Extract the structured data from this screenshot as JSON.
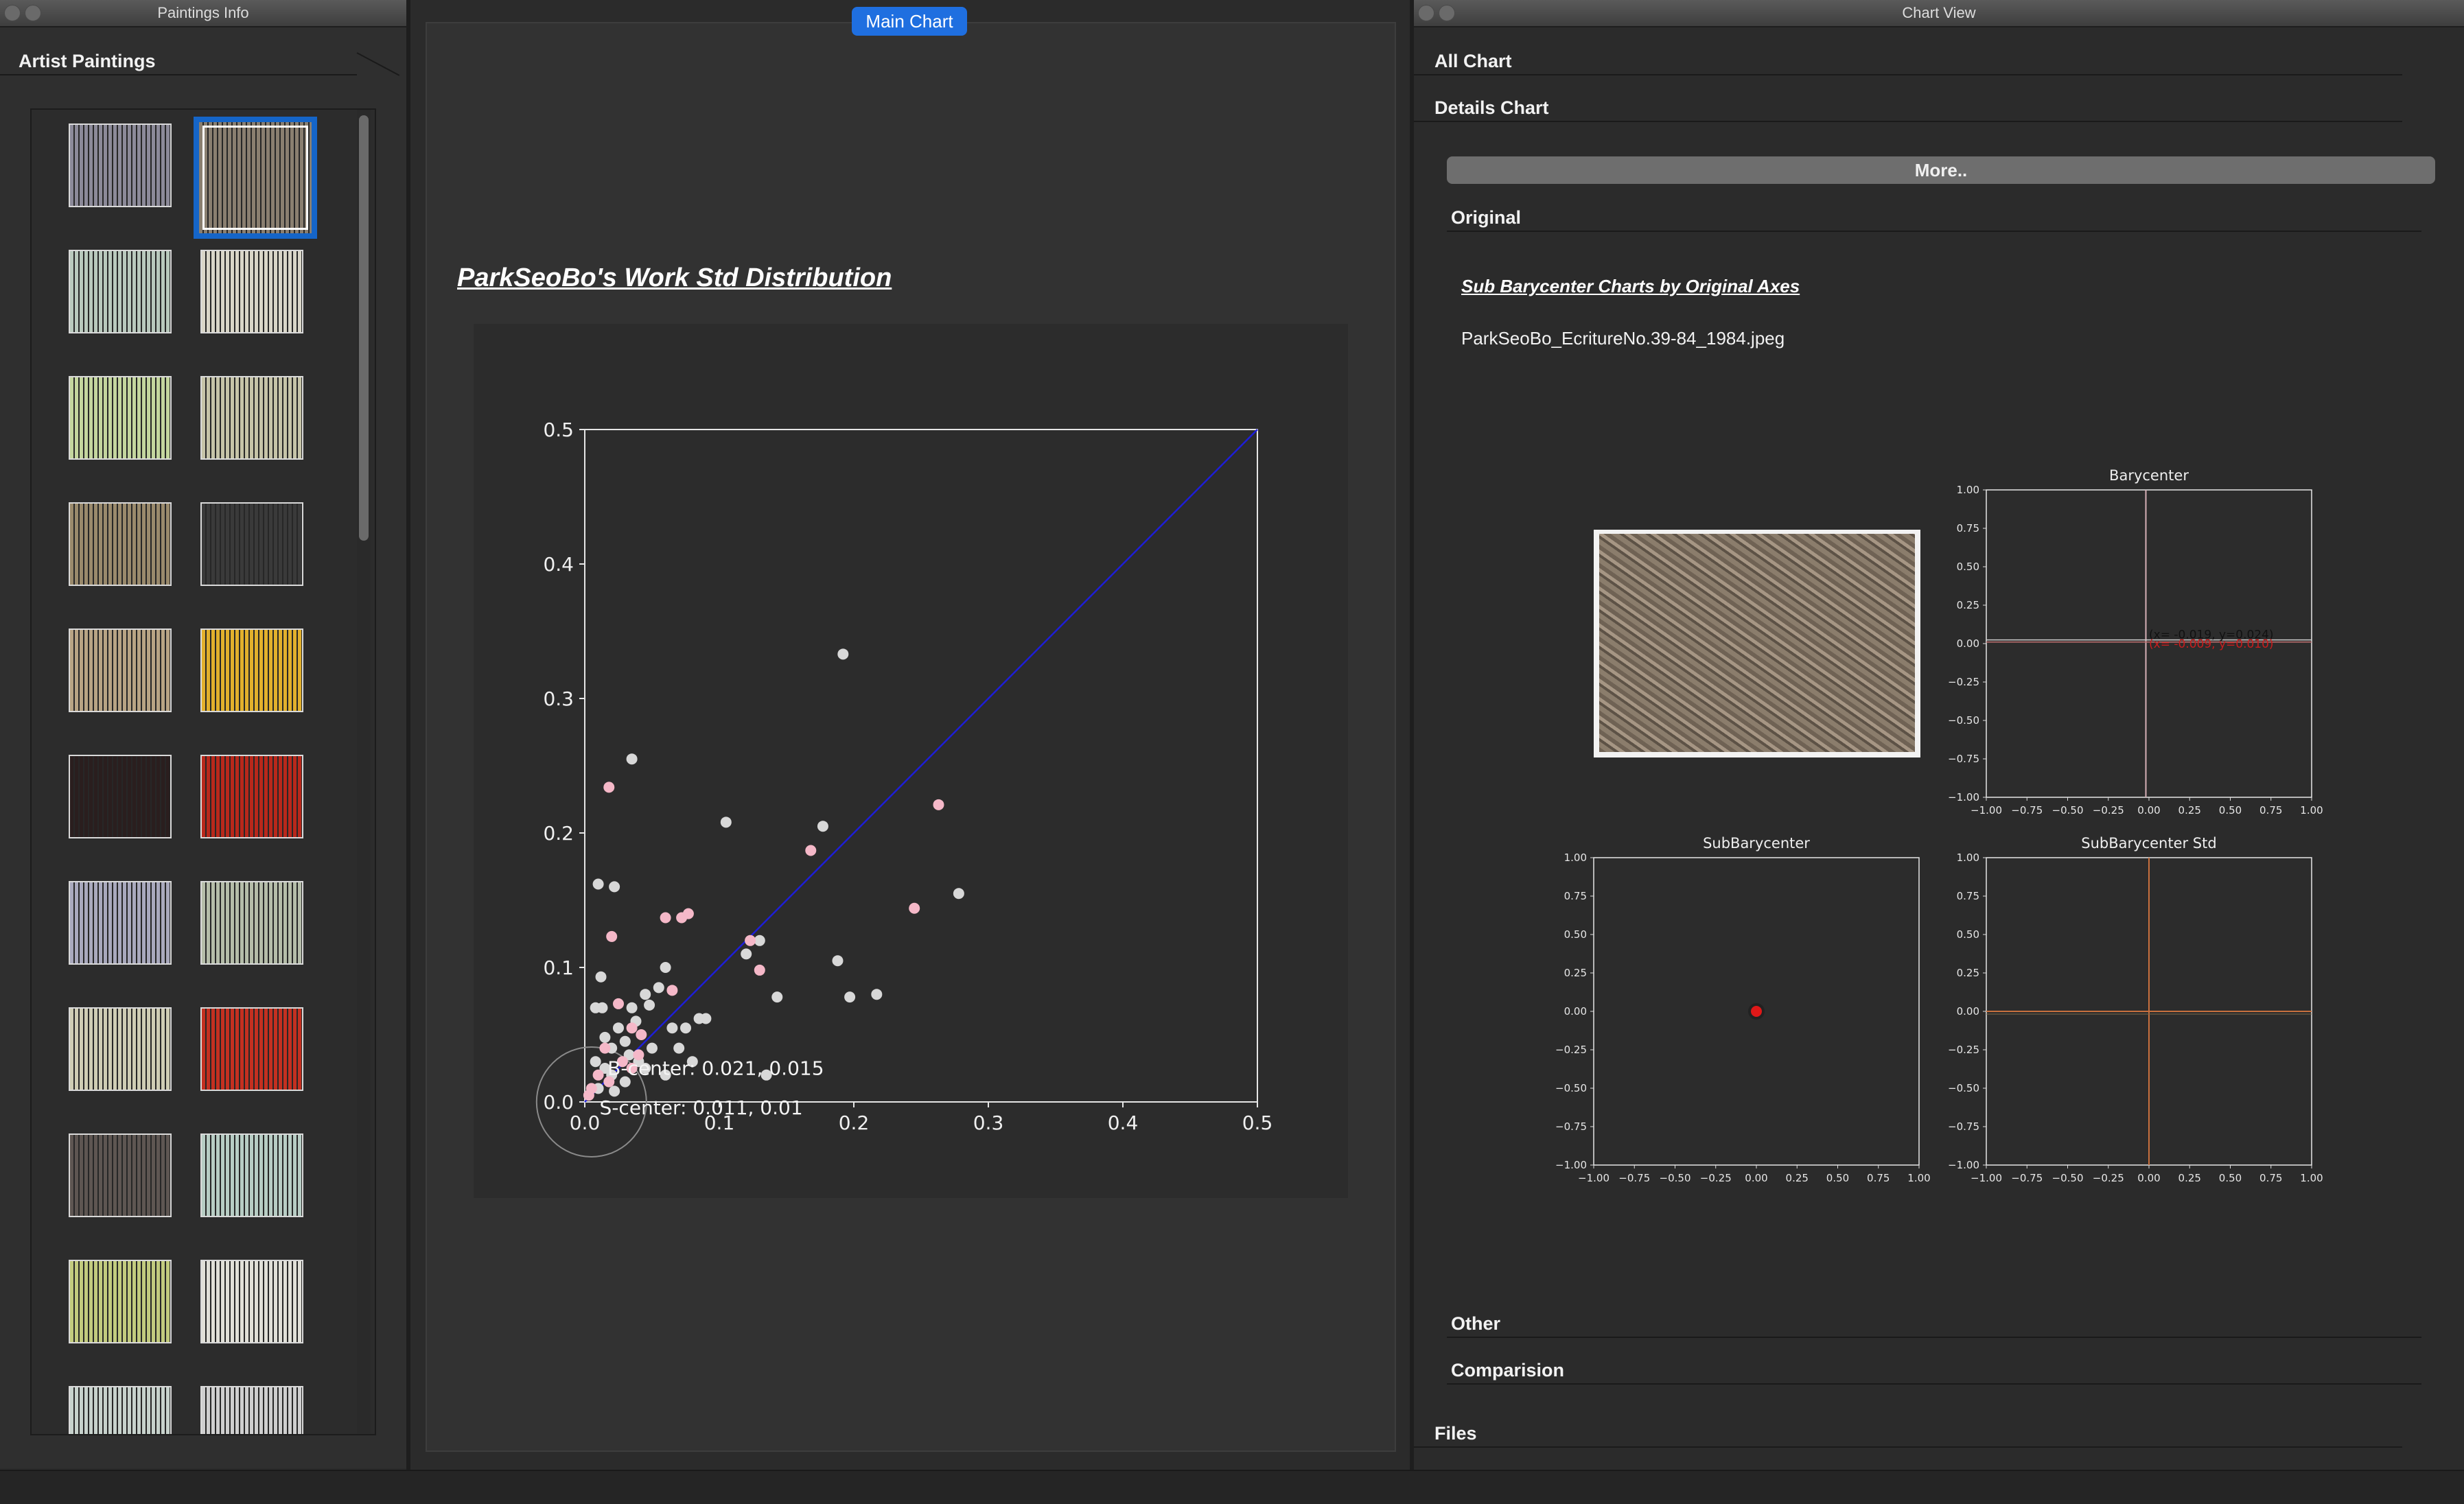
{
  "left_window": {
    "title": "Paintings Info",
    "section": "Artist Paintings"
  },
  "thumbnails": [
    {
      "color": "#8c8a99"
    },
    {
      "color": "#8a7f70"
    },
    {
      "color": "#b9c9bd"
    },
    {
      "color": "#d9d6c8"
    },
    {
      "color": "#c4d69e"
    },
    {
      "color": "#c6c4a8"
    },
    {
      "color": "#9a8a6c"
    },
    {
      "color": "#3a3a3a"
    },
    {
      "color": "#b8a484"
    },
    {
      "color": "#e2b02c"
    },
    {
      "color": "#2a1e1e"
    },
    {
      "color": "#b9281b"
    },
    {
      "color": "#a9a9bd"
    },
    {
      "color": "#b5bda9"
    },
    {
      "color": "#cfcdb4"
    },
    {
      "color": "#c43020"
    },
    {
      "color": "#5e5652"
    },
    {
      "color": "#b7cdc4"
    },
    {
      "color": "#c2cb7e"
    },
    {
      "color": "#e1e0d8"
    },
    {
      "color": "#c7d2cc"
    },
    {
      "color": "#cfcfcf"
    }
  ],
  "center": {
    "tab_label": "Main Chart",
    "title": "ParkSeoBo's Work Std Distribution"
  },
  "right_window": {
    "title": "Chart View",
    "sections": {
      "all": "All Chart",
      "details": "Details Chart",
      "original": "Original",
      "other": "Other",
      "comparison": "Comparision",
      "files": "Files"
    },
    "more_button": "More..",
    "sub_title": "Sub Barycenter Charts by Original Axes",
    "filename": "ParkSeoBo_EcritureNo.39-84_1984.jpeg"
  },
  "chart_data": [
    {
      "type": "scatter",
      "title": "ParkSeoBo's Work Std Distribution",
      "xlim": [
        0,
        0.5
      ],
      "ylim": [
        0,
        0.5
      ],
      "xticks": [
        "0.0",
        "0.1",
        "0.2",
        "0.3",
        "0.4",
        "0.5"
      ],
      "yticks": [
        "0.0",
        "0.1",
        "0.2",
        "0.3",
        "0.4",
        "0.5"
      ],
      "grid": false,
      "series": [
        {
          "color": "#d8d8d8",
          "points": [
            [
              0.192,
              0.333
            ],
            [
              0.035,
              0.255
            ],
            [
              0.105,
              0.208
            ],
            [
              0.177,
              0.205
            ],
            [
              0.278,
              0.155
            ],
            [
              0.01,
              0.162
            ],
            [
              0.022,
              0.16
            ],
            [
              0.13,
              0.12
            ],
            [
              0.188,
              0.105
            ],
            [
              0.12,
              0.11
            ],
            [
              0.197,
              0.078
            ],
            [
              0.217,
              0.08
            ],
            [
              0.143,
              0.078
            ],
            [
              0.012,
              0.093
            ],
            [
              0.06,
              0.1
            ],
            [
              0.055,
              0.085
            ],
            [
              0.045,
              0.08
            ],
            [
              0.048,
              0.072
            ],
            [
              0.035,
              0.07
            ],
            [
              0.008,
              0.07
            ],
            [
              0.013,
              0.07
            ],
            [
              0.038,
              0.06
            ],
            [
              0.065,
              0.055
            ],
            [
              0.075,
              0.055
            ],
            [
              0.085,
              0.062
            ],
            [
              0.09,
              0.062
            ],
            [
              0.025,
              0.055
            ],
            [
              0.03,
              0.045
            ],
            [
              0.05,
              0.04
            ],
            [
              0.07,
              0.04
            ],
            [
              0.015,
              0.048
            ],
            [
              0.02,
              0.04
            ],
            [
              0.033,
              0.035
            ],
            [
              0.04,
              0.03
            ],
            [
              0.045,
              0.025
            ],
            [
              0.06,
              0.02
            ],
            [
              0.08,
              0.03
            ],
            [
              0.008,
              0.03
            ],
            [
              0.015,
              0.025
            ],
            [
              0.02,
              0.02
            ],
            [
              0.03,
              0.015
            ],
            [
              0.01,
              0.01
            ],
            [
              0.022,
              0.008
            ],
            [
              0.135,
              0.02
            ]
          ]
        },
        {
          "color": "#f5b8c8",
          "points": [
            [
              0.018,
              0.234
            ],
            [
              0.263,
              0.221
            ],
            [
              0.168,
              0.187
            ],
            [
              0.245,
              0.144
            ],
            [
              0.077,
              0.14
            ],
            [
              0.072,
              0.137
            ],
            [
              0.06,
              0.137
            ],
            [
              0.02,
              0.123
            ],
            [
              0.123,
              0.12
            ],
            [
              0.13,
              0.098
            ],
            [
              0.065,
              0.083
            ],
            [
              0.025,
              0.073
            ],
            [
              0.035,
              0.055
            ],
            [
              0.042,
              0.05
            ],
            [
              0.015,
              0.04
            ],
            [
              0.028,
              0.03
            ],
            [
              0.01,
              0.02
            ],
            [
              0.005,
              0.01
            ],
            [
              0.018,
              0.015
            ],
            [
              0.035,
              0.025
            ],
            [
              0.04,
              0.035
            ],
            [
              0.003,
              0.005
            ]
          ]
        }
      ],
      "annotations": [
        "B-center: 0.021, 0.015",
        "S-center: 0.011, 0.01"
      ],
      "line_color": "#1e1ed8"
    },
    {
      "type": "scatter",
      "title": "Barycenter",
      "xlim": [
        -1,
        1
      ],
      "ylim": [
        -1,
        1
      ],
      "ticks": [
        "−1.00",
        "−0.75",
        "−0.50",
        "−0.25",
        "0.00",
        "0.25",
        "0.50",
        "0.75",
        "1.00"
      ],
      "annotations": [
        "(x= -0.019, y=0.024)",
        "(x= -0.009, y=0.010)"
      ]
    },
    {
      "type": "scatter",
      "title": "SubBarycenter",
      "xlim": [
        -1,
        1
      ],
      "ylim": [
        -1,
        1
      ],
      "ticks": [
        "−1.00",
        "−0.75",
        "−0.50",
        "−0.25",
        "0.00",
        "0.25",
        "0.50",
        "0.75",
        "1.00"
      ]
    },
    {
      "type": "scatter",
      "title": "SubBarycenter Std",
      "xlim": [
        -1,
        1
      ],
      "ylim": [
        -1,
        1
      ],
      "ticks": [
        "−1.00",
        "−0.75",
        "−0.50",
        "−0.25",
        "0.00",
        "0.25",
        "0.50",
        "0.75",
        "1.00"
      ]
    }
  ]
}
